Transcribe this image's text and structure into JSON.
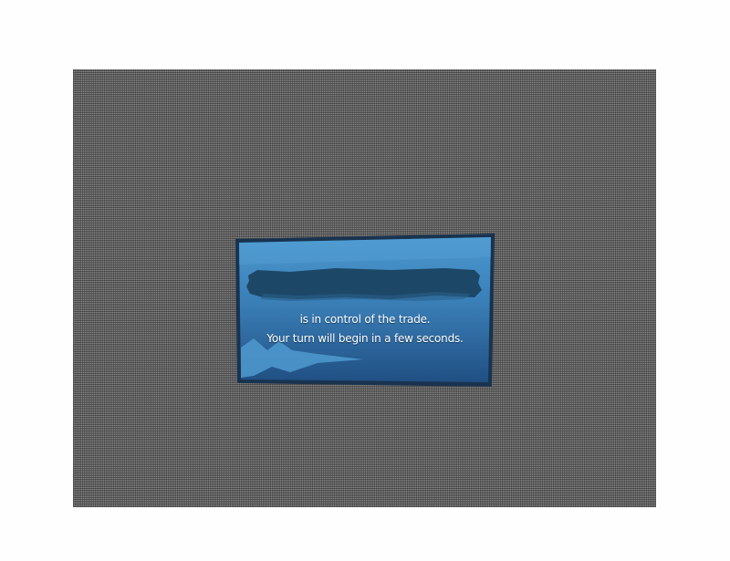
{
  "trade_notice": {
    "player_name": "",
    "line1": "is in control of the trade.",
    "line2": "Your turn will begin  in a few seconds."
  },
  "colors": {
    "overlay": "#8a8a8a",
    "panel_top": "#3d86bf",
    "panel_bottom": "#1f4f82",
    "panel_border": "#1a3558",
    "name_plate": "#1e4a6b",
    "text": "#ffffff"
  }
}
